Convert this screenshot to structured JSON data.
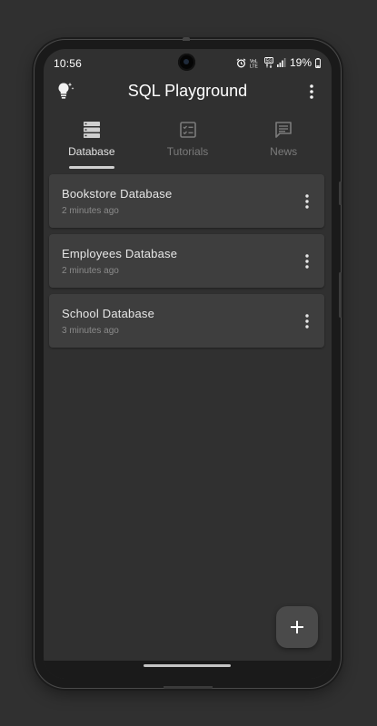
{
  "status_bar": {
    "time": "10:56",
    "battery": "19%",
    "network": "LTE"
  },
  "app_bar": {
    "title": "SQL Playground",
    "left_icon": "lightbulb-icon",
    "right_icon": "more-vert-icon"
  },
  "tabs": [
    {
      "label": "Database",
      "icon": "database-icon",
      "active": true
    },
    {
      "label": "Tutorials",
      "icon": "checklist-icon",
      "active": false
    },
    {
      "label": "News",
      "icon": "news-icon",
      "active": false
    }
  ],
  "databases": [
    {
      "name": "Bookstore Database",
      "time": "2 minutes ago"
    },
    {
      "name": "Employees Database",
      "time": "2 minutes ago"
    },
    {
      "name": "School Database",
      "time": "3 minutes ago"
    }
  ],
  "fab": {
    "icon": "plus-icon"
  },
  "colors": {
    "background": "#303030",
    "card": "#3e3e3e",
    "text_primary": "#e6e6e6",
    "text_secondary": "#8a8a8a",
    "tab_inactive": "#7b7b7b"
  }
}
